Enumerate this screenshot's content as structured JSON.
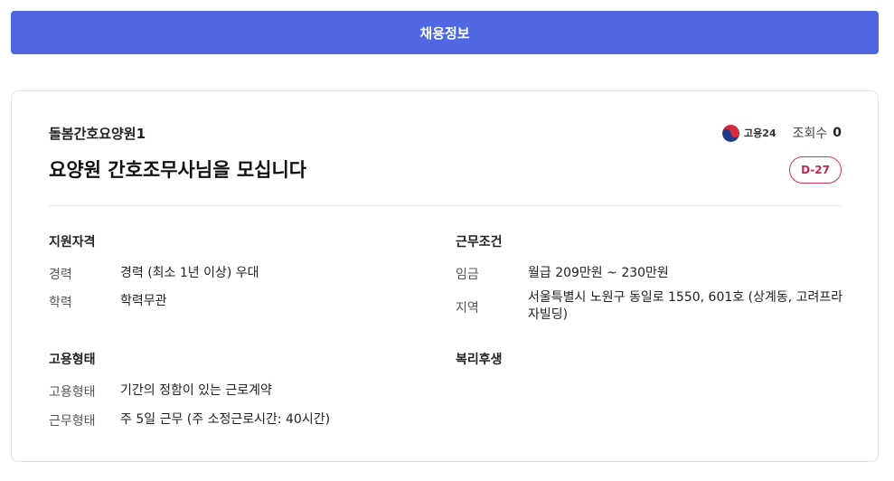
{
  "tab": {
    "label": "채용정보"
  },
  "job": {
    "company": "돌봄간호요양원1",
    "title": "요양원 간호조무사님을 모십니다",
    "source": "고용24",
    "views_label": "조회수",
    "views_count": "0",
    "dday": "D-27"
  },
  "sections": {
    "qualifications": {
      "title": "지원자격",
      "rows": [
        {
          "label": "경력",
          "value": "경력 (최소 1년 이상) 우대"
        },
        {
          "label": "학력",
          "value": "학력무관"
        }
      ]
    },
    "conditions": {
      "title": "근무조건",
      "rows": [
        {
          "label": "임금",
          "value": "월급 209만원 ~ 230만원"
        },
        {
          "label": "지역",
          "value": "서울특별시 노원구 동일로 1550, 601호 (상계동, 고려프라자빌딩)"
        }
      ]
    },
    "employment": {
      "title": "고용형태",
      "rows": [
        {
          "label": "고용형태",
          "value": "기간의 정함이 있는 근로계약"
        },
        {
          "label": "근무형태",
          "value": "주 5일 근무 (주 소정근로시간: 40시간)"
        }
      ]
    },
    "benefits": {
      "title": "복리후생"
    }
  },
  "colors": {
    "accent": "#4f67e2",
    "dday": "#c7254e"
  }
}
